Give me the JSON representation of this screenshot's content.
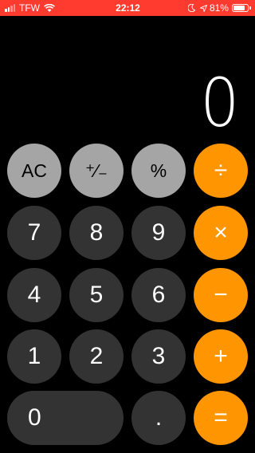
{
  "status_bar": {
    "carrier": "TFW",
    "time": "22:12",
    "battery_percent": "81%",
    "battery_level": 0.81,
    "signal_bars_filled": 2,
    "signal_bars_total": 4,
    "icons": [
      "signal-icon",
      "wifi-icon",
      "moon-icon",
      "location-arrow-icon",
      "battery-icon"
    ],
    "background_color": "#ff3b30"
  },
  "display": {
    "value": "0"
  },
  "keys": {
    "clear": "AC",
    "sign": "⁺∕₋",
    "percent": "%",
    "divide": "÷",
    "seven": "7",
    "eight": "8",
    "nine": "9",
    "multiply": "×",
    "four": "4",
    "five": "5",
    "six": "6",
    "minus": "−",
    "one": "1",
    "two": "2",
    "three": "3",
    "plus": "+",
    "zero": "0",
    "decimal": ".",
    "equals": "="
  },
  "colors": {
    "function_key": "#a5a5a5",
    "number_key": "#333333",
    "operator_key": "#ff9500",
    "background": "#000000"
  }
}
